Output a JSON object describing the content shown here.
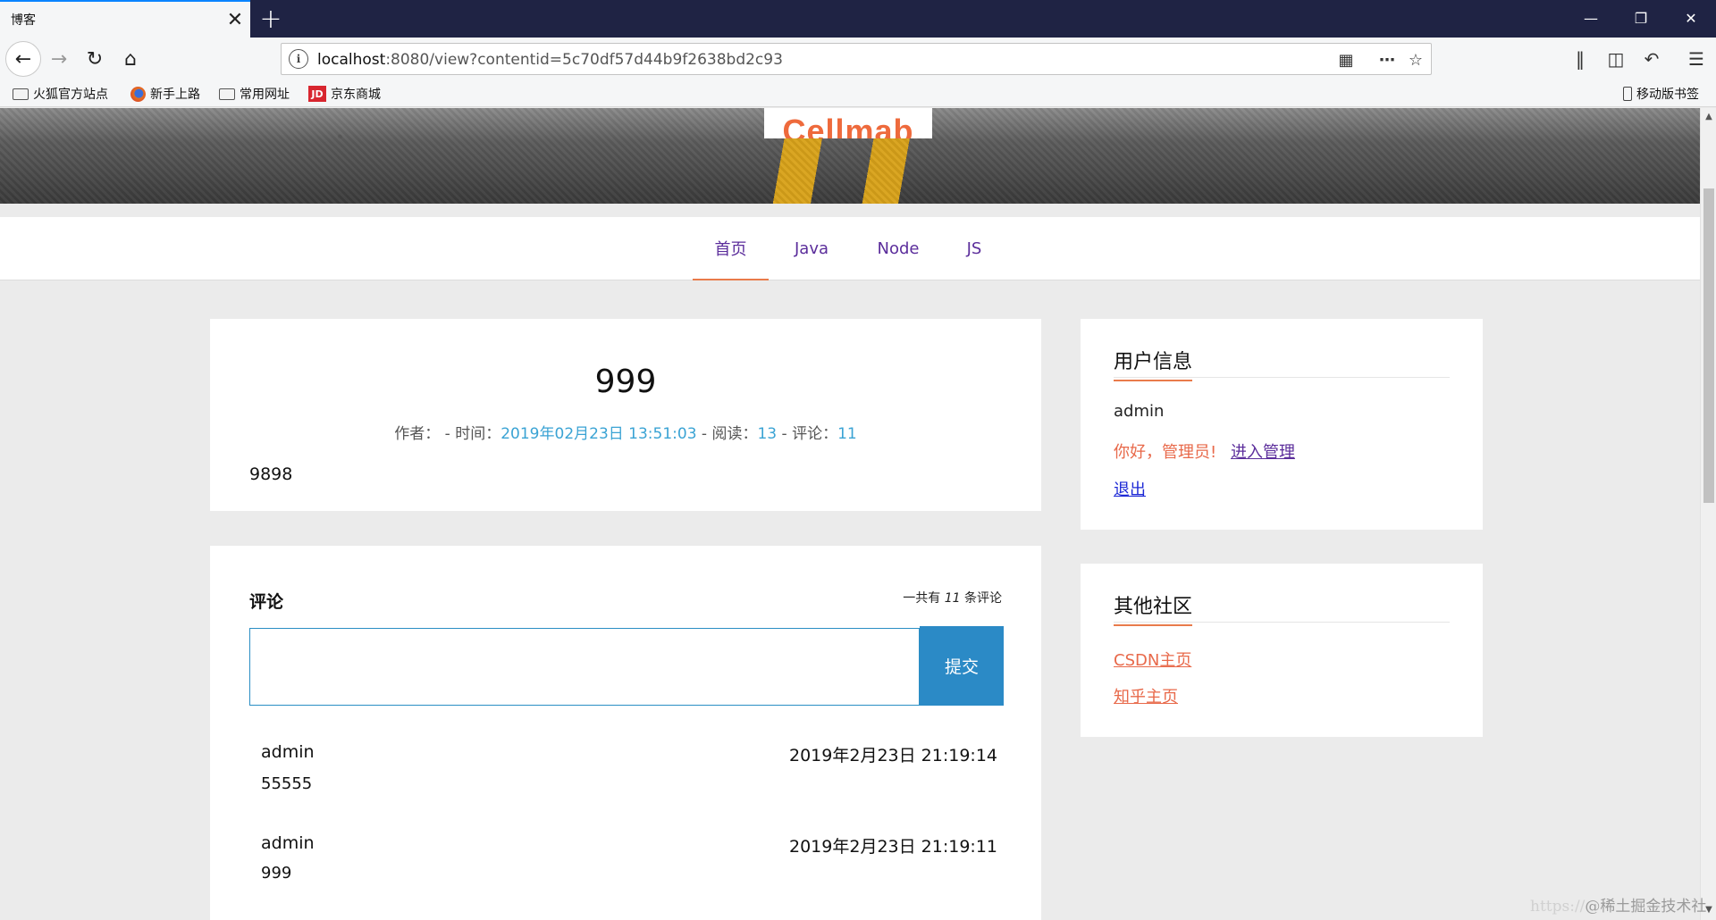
{
  "browser": {
    "tab_title": "博客",
    "tab_close": "✕",
    "new_tab": "+",
    "url_host": "localhost",
    "url_rest": ":8080/view?contentid=5c70df57d44b9f2638bd2c93",
    "bookmarks": [
      {
        "label": "火狐官方站点",
        "icon": "folder-icon"
      },
      {
        "label": "新手上路",
        "icon": "firefox-icon"
      },
      {
        "label": "常用网址",
        "icon": "folder-icon"
      },
      {
        "label": "京东商城",
        "icon": "jd-icon"
      }
    ],
    "mobile_bookmarks": "移动版书签"
  },
  "site": {
    "logo": "Cellmab",
    "nav": [
      "首页",
      "Java",
      "Node",
      "JS"
    ],
    "active_nav": "首页"
  },
  "article": {
    "title": "999",
    "meta": {
      "author_label": "作者：",
      "time_label": " - 时间：",
      "time": "2019年02月23日 13:51:03",
      "views_label": " - 阅读：",
      "views": "13",
      "comments_label": " - 评论：",
      "comments": "11"
    },
    "body": "9898"
  },
  "comments": {
    "title": "评论",
    "count_prefix": "一共有 ",
    "count": "11",
    "count_suffix": " 条评论",
    "submit_label": "提交",
    "input_value": "",
    "items": [
      {
        "user": "admin",
        "time": "2019年2月23日 21:19:14",
        "text": "55555"
      },
      {
        "user": "admin",
        "time": "2019年2月23日 21:19:11",
        "text": "999"
      }
    ]
  },
  "user_info": {
    "title": "用户信息",
    "username": "admin",
    "greeting": "你好，管理员!",
    "admin_link": "进入管理",
    "logout": "退出"
  },
  "other_communities": {
    "title": "其他社区",
    "links": [
      "CSDN主页",
      "知乎主页"
    ]
  },
  "watermark": {
    "prefix": "https://",
    "text": "@稀土掘金技术社区"
  },
  "colors": {
    "accent_orange": "#e8694a",
    "link_blue": "#3aa3d4",
    "button_blue": "#2b8ac6",
    "nav_purple": "#5b2d9b"
  }
}
